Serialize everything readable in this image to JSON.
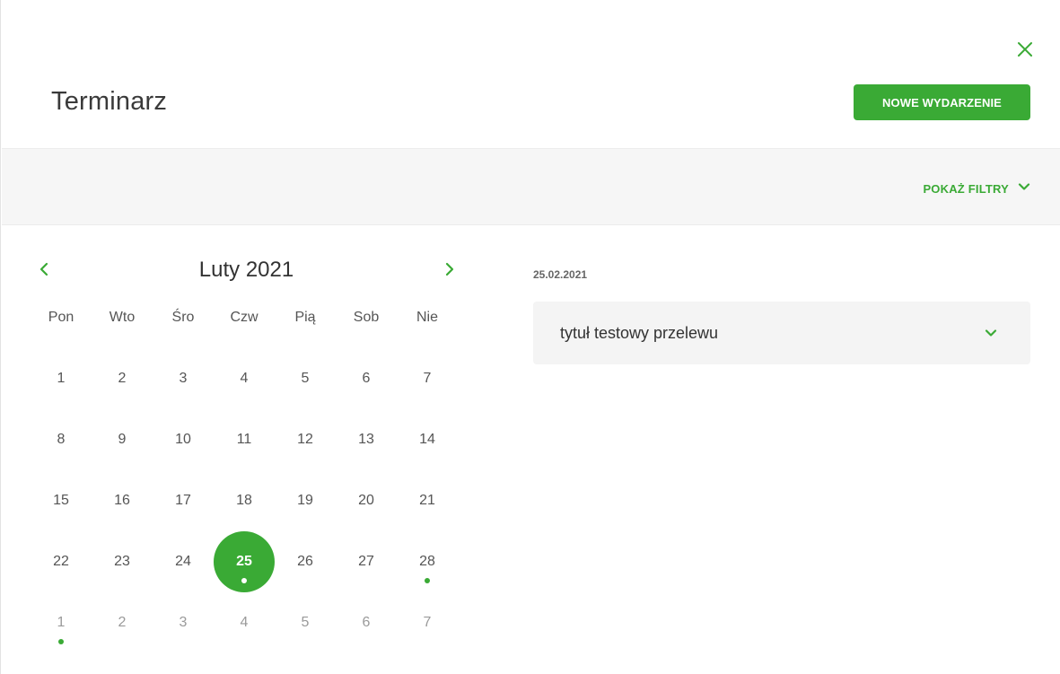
{
  "header": {
    "title": "Terminarz",
    "new_event_label": "NOWE WYDARZENIE",
    "close_icon": "close-icon"
  },
  "filters": {
    "toggle_label": "POKAŻ FILTRY",
    "icon": "chevron-down-icon"
  },
  "calendar": {
    "month_label": "Luty 2021",
    "prev_icon": "chevron-left-icon",
    "next_icon": "chevron-right-icon",
    "weekdays": [
      "Pon",
      "Wto",
      "Śro",
      "Czw",
      "Pią",
      "Sob",
      "Nie"
    ],
    "weeks": [
      [
        {
          "d": "1"
        },
        {
          "d": "2"
        },
        {
          "d": "3"
        },
        {
          "d": "4"
        },
        {
          "d": "5"
        },
        {
          "d": "6"
        },
        {
          "d": "7"
        }
      ],
      [
        {
          "d": "8"
        },
        {
          "d": "9"
        },
        {
          "d": "10"
        },
        {
          "d": "11"
        },
        {
          "d": "12"
        },
        {
          "d": "13"
        },
        {
          "d": "14"
        }
      ],
      [
        {
          "d": "15"
        },
        {
          "d": "16"
        },
        {
          "d": "17"
        },
        {
          "d": "18"
        },
        {
          "d": "19"
        },
        {
          "d": "20"
        },
        {
          "d": "21"
        }
      ],
      [
        {
          "d": "22"
        },
        {
          "d": "23"
        },
        {
          "d": "24"
        },
        {
          "d": "25",
          "selected": true,
          "event": true
        },
        {
          "d": "26"
        },
        {
          "d": "27"
        },
        {
          "d": "28",
          "event": true
        }
      ],
      [
        {
          "d": "1",
          "muted": true,
          "event": true
        },
        {
          "d": "2",
          "muted": true
        },
        {
          "d": "3",
          "muted": true
        },
        {
          "d": "4",
          "muted": true
        },
        {
          "d": "5",
          "muted": true
        },
        {
          "d": "6",
          "muted": true
        },
        {
          "d": "7",
          "muted": true
        }
      ]
    ]
  },
  "events": {
    "selected_date": "25.02.2021",
    "items": [
      {
        "title": "tytuł testowy przelewu",
        "icon": "chevron-down-icon"
      }
    ]
  },
  "colors": {
    "accent": "#3aaa35",
    "filter_bar_bg": "#f6f6f6",
    "event_bg": "#f4f4f4"
  }
}
